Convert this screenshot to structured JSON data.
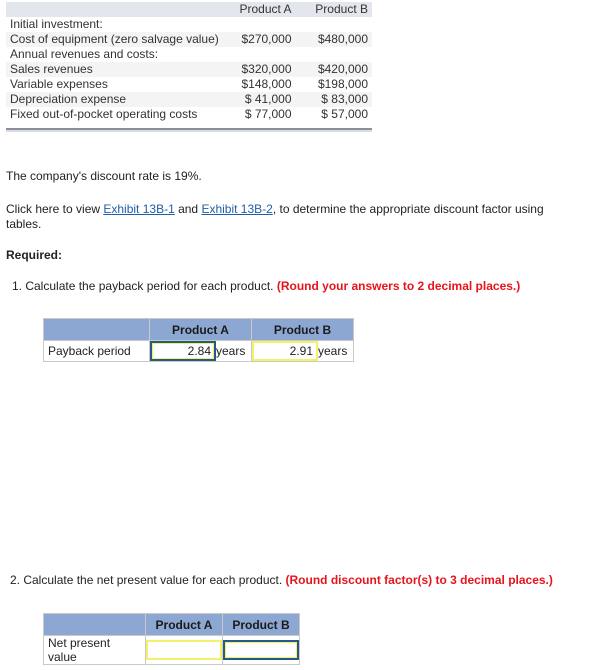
{
  "data_table": {
    "headers": [
      "",
      "Product A",
      "Product B"
    ],
    "rows": [
      {
        "label": "Initial investment:",
        "a": "",
        "b": ""
      },
      {
        "label": "Cost of equipment (zero salvage value)",
        "a": "$270,000",
        "b": "$480,000"
      },
      {
        "label": "Annual revenues and costs:",
        "a": "",
        "b": ""
      },
      {
        "label": "Sales revenues",
        "a": "$320,000",
        "b": "$420,000"
      },
      {
        "label": "Variable expenses",
        "a": "$148,000",
        "b": "$198,000"
      },
      {
        "label": "Depreciation expense",
        "a": "$ 41,000",
        "b": "$ 83,000"
      },
      {
        "label": "Fixed out-of-pocket operating costs",
        "a": "$ 77,000",
        "b": "$ 57,000"
      }
    ]
  },
  "discount_text": "The company's discount rate is 19%.",
  "exhibit": {
    "prefix": "Click here to view ",
    "link1": "Exhibit 13B-1",
    "middle": " and ",
    "link2": "Exhibit 13B-2",
    "suffix": ", to determine the appropriate discount factor using tables."
  },
  "required_label": "Required:",
  "q1": {
    "text": "1. Calculate the payback period for each product.",
    "note": "(Round your answers to 2 decimal places.)",
    "headers": [
      "",
      "Product A",
      "Product B"
    ],
    "row_label": "Payback period",
    "a_value": "2.84",
    "b_value": "2.91",
    "unit": "years"
  },
  "q2": {
    "text": "2. Calculate the net present value for each product.",
    "note": "(Round discount factor(s) to 3 decimal places.)",
    "headers": [
      "",
      "Product A",
      "Product B"
    ],
    "row_label": "Net present value",
    "a_value": "",
    "b_value": ""
  }
}
